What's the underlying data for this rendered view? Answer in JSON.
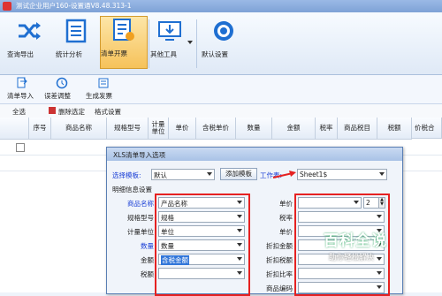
{
  "window": {
    "title": "测试企业用户160-设置通V8.48.313-1"
  },
  "ribbon": {
    "buttons": [
      {
        "label": "查询导出",
        "icon": "shuffle-icon"
      },
      {
        "label": "统计分析",
        "icon": "ledger-icon"
      },
      {
        "label": "清单开票",
        "icon": "list-invoice-icon",
        "selected": true
      },
      {
        "label": "其他工具",
        "icon": "monitor-download-icon"
      },
      {
        "label": "默认设置",
        "icon": "gear-icon"
      }
    ]
  },
  "toolbar2": {
    "buttons": [
      {
        "label": "清单导入",
        "icon": "import-icon"
      },
      {
        "label": "误差调整",
        "icon": "adjust-icon"
      },
      {
        "label": "生成发票",
        "icon": "invoice-icon"
      }
    ]
  },
  "toolbar3": {
    "select_all": "全选",
    "delete_selected": "删除选定",
    "format_settings": "格式设置"
  },
  "grid": {
    "headers": [
      "序号",
      "商品名称",
      "规格型号",
      "计量单位",
      "单价",
      "含税单价",
      "数量",
      "金额",
      "税率",
      "商品税目",
      "税额",
      "价税合"
    ]
  },
  "dialog": {
    "title": "XLS清单导入选项",
    "template_label": "选择模板:",
    "template_value": "默认",
    "add_template_button": "添加模板",
    "worksheet_label": "工作表:",
    "worksheet_value": "Sheet1$",
    "section_label": "明细信息设置",
    "left_fields": [
      {
        "label": "商品名称",
        "value": "产品名称",
        "highlight": true
      },
      {
        "label": "规格型号",
        "value": "规格",
        "highlight": false
      },
      {
        "label": "计量单位",
        "value": "单位",
        "highlight": false
      },
      {
        "label": "数量",
        "value": "数量",
        "highlight": true
      },
      {
        "label": "金额",
        "value": "含税金额",
        "highlight": false
      },
      {
        "label": "税额",
        "value": "",
        "highlight": false
      }
    ],
    "right_fields": [
      {
        "label": "单价",
        "value": ""
      },
      {
        "label": "税率",
        "value": ""
      },
      {
        "label": "单价",
        "value": ""
      },
      {
        "label": "折扣金额",
        "value": ""
      },
      {
        "label": "折扣税额",
        "value": ""
      },
      {
        "label": "折扣比率",
        "value": ""
      },
      {
        "label": "商品编码",
        "value": ""
      }
    ],
    "precision_value": "2"
  },
  "watermark": {
    "brand": "百科全说",
    "tagline": "助你轻松解决"
  },
  "colors": {
    "highlight_red": "#e52121",
    "link_blue": "#1a3fd6",
    "ribbon_selected": "#f6c25a"
  }
}
